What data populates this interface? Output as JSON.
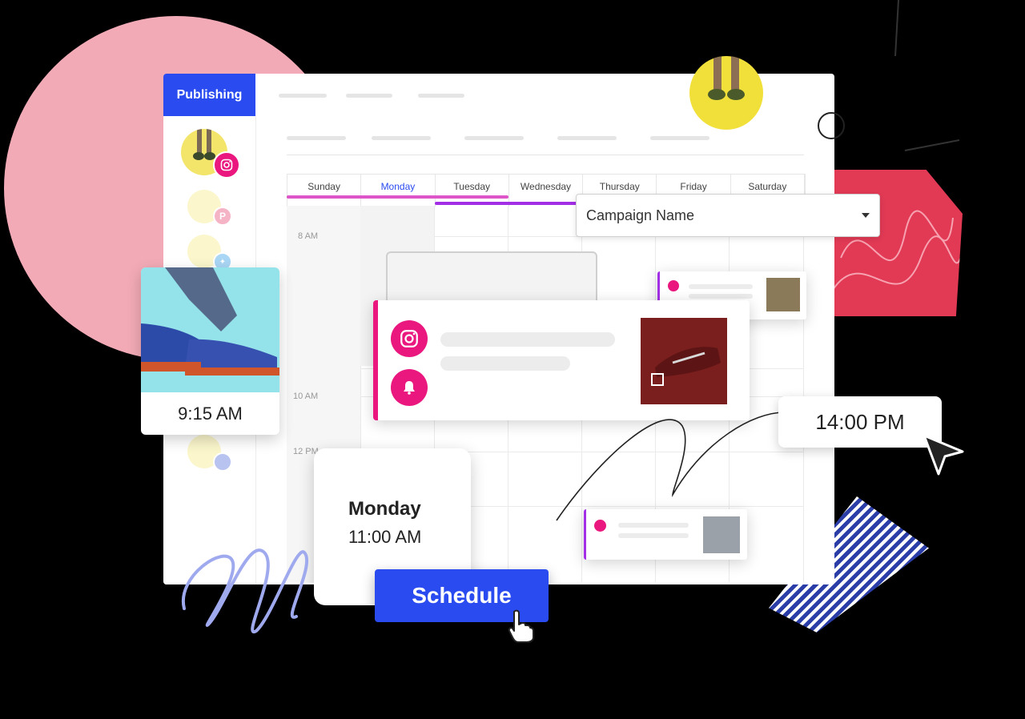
{
  "sidebar": {
    "tab_label": "Publishing"
  },
  "calendar": {
    "days": [
      "Sunday",
      "Monday",
      "Tuesday",
      "Wednesday",
      "Thursday",
      "Friday",
      "Saturday"
    ],
    "active_day": "Monday",
    "time_labels": [
      "8 AM",
      "10 AM",
      "12 PM"
    ]
  },
  "campaign_select": {
    "value": "Campaign Name"
  },
  "photo_card": {
    "time": "9:15 AM"
  },
  "time_bubble": {
    "time": "14:00 PM"
  },
  "date_card": {
    "day": "Monday",
    "time": "11:00 AM"
  },
  "schedule_button": {
    "label": "Schedule"
  },
  "colors": {
    "accent": "#2a4bf0",
    "instagram_pink": "#e9177e",
    "purple": "#a22ee6",
    "background_pink": "#f2aab6",
    "red_shape": "#e23a55"
  },
  "icons": [
    "instagram-icon",
    "pinterest-icon",
    "twitter-icon",
    "bell-icon",
    "cursor-arrow-icon",
    "hand-pointer-icon",
    "dropdown-caret-icon"
  ]
}
